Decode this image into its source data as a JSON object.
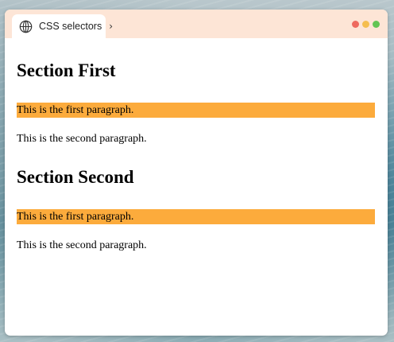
{
  "tab": {
    "title": "CSS selectors",
    "icon": "globe-icon",
    "chevron": "›"
  },
  "window_controls": {
    "close_color": "#ee6a5f",
    "minimize_color": "#f5be4f",
    "maximize_color": "#62c554"
  },
  "colors": {
    "title_bar": "#fde5d6",
    "highlight": "#fcab3c"
  },
  "sections": [
    {
      "heading": "Section First",
      "paragraphs": [
        "This is the first paragraph.",
        "This is the second paragraph."
      ]
    },
    {
      "heading": "Section Second",
      "paragraphs": [
        "This is the first paragraph.",
        "This is the second paragraph."
      ]
    }
  ]
}
